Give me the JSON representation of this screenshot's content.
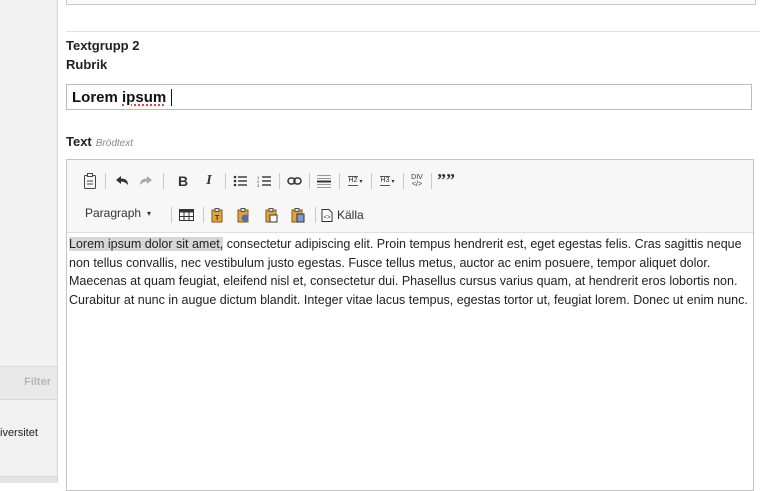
{
  "sidebar": {
    "filter_label": "Filter",
    "item_label": "iversitet"
  },
  "form": {
    "group_title": "Textgrupp 2",
    "rubrik_label": "Rubrik",
    "rubrik_value_part1": "Lorem ",
    "rubrik_value_part2": "ipsum",
    "text_label": "Text",
    "text_hint": "Brödtext"
  },
  "toolbar": {
    "bold": "B",
    "italic": "I",
    "h2": "H2",
    "h3": "H3",
    "div": "DIV",
    "quote": "””",
    "paragraph_select": "Paragraph",
    "source_label": "Källa"
  },
  "editor": {
    "highlighted": "Lorem ipsum dolor sit amet,",
    "body": " consectetur adipiscing elit. Proin tempus hendrerit est, eget egestas felis. Cras sagittis neque non tellus convallis, nec vestibulum justo egestas. Fusce tellus metus, auctor ac enim posuere, tempor aliquet dolor. Maecenas at quam feugiat, eleifend nisl et, consectetur dui. Phasellus cursus varius quam, at hendrerit eros lobortis non. Curabitur at nunc in augue dictum blandit. Integer vitae lacus tempus, egestas tortor ut, feugiat lorem. Donec ut enim nunc."
  }
}
